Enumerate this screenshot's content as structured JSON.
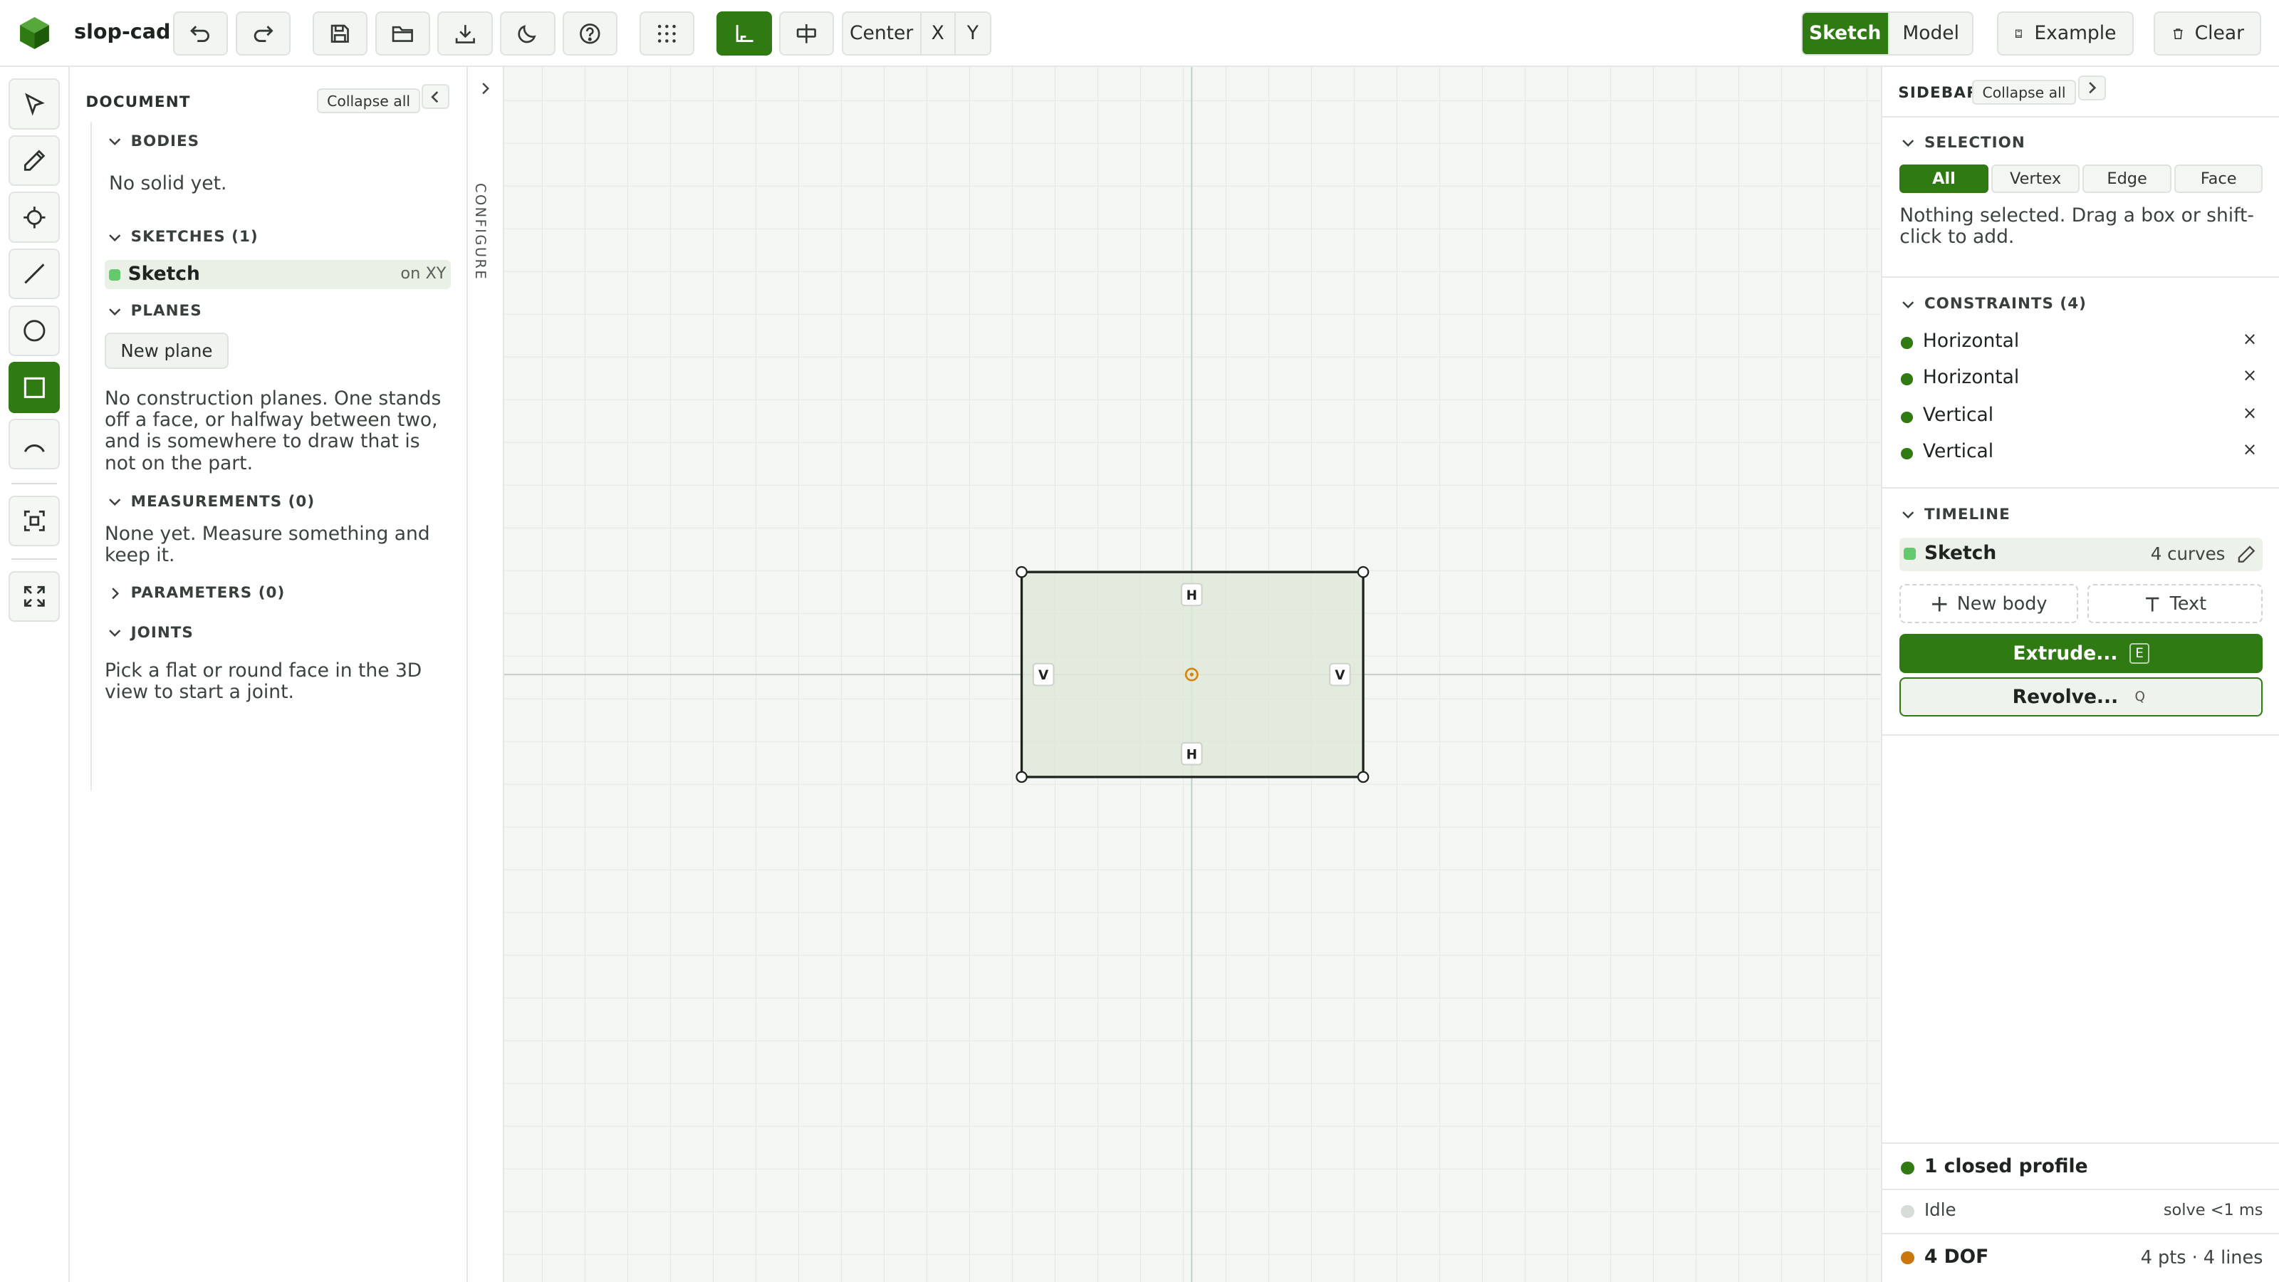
{
  "app": {
    "name": "slop-cad"
  },
  "toolbar": {
    "snap_mode": "Center",
    "axis_x": "X",
    "axis_y": "Y",
    "mode_sketch": "Sketch",
    "mode_model": "Model",
    "example": "Example",
    "clear": "Clear"
  },
  "document": {
    "title": "DOCUMENT",
    "collapse_all": "Collapse all",
    "bodies": {
      "title": "BODIES",
      "empty": "No solid yet."
    },
    "sketches": {
      "title": "SKETCHES (1)",
      "items": [
        {
          "name": "Sketch",
          "plane": "on XY"
        }
      ]
    },
    "planes": {
      "title": "PLANES",
      "new_plane": "New plane",
      "empty": "No construction planes. One stands off a face, or halfway between two, and is somewhere to draw that is not on the part."
    },
    "measurements": {
      "title": "MEASUREMENTS (0)",
      "empty": "None yet. Measure something and keep it."
    },
    "parameters": {
      "title": "PARAMETERS (0)"
    },
    "joints": {
      "title": "JOINTS",
      "empty": "Pick a flat or round face in the 3D view to start a joint."
    }
  },
  "configure": {
    "label": "CONFIGURE"
  },
  "canvas": {
    "constraint_labels": {
      "top": "H",
      "bottom": "H",
      "left": "V",
      "right": "V"
    }
  },
  "sidebar": {
    "title": "SIDEBAR",
    "collapse_all": "Collapse all",
    "selection": {
      "title": "SELECTION",
      "filters": [
        "All",
        "Vertex",
        "Edge",
        "Face"
      ],
      "active_filter": "All",
      "hint": "Nothing selected. Drag a box or shift-click to add."
    },
    "constraints": {
      "title": "CONSTRAINTS (4)",
      "items": [
        "Horizontal",
        "Horizontal",
        "Vertical",
        "Vertical"
      ],
      "remove_glyph": "×"
    },
    "timeline": {
      "title": "TIMELINE",
      "items": [
        {
          "name": "Sketch",
          "meta": "4 curves"
        }
      ],
      "new_body": "New body",
      "text": "Text",
      "extrude": "Extrude...",
      "extrude_key": "E",
      "revolve": "Revolve...",
      "revolve_key": "Q"
    }
  },
  "status": {
    "profile": "1 closed profile",
    "state": "Idle",
    "solve": "solve <1 ms",
    "dof": "4 DOF",
    "counts": "4 pts · 4 lines"
  },
  "colors": {
    "accent": "#2f7a12",
    "sketch_dot": "#63c96b",
    "dof_dot": "#c9760d",
    "idle_dot": "#d8dcd8",
    "origin": "#d4870f"
  },
  "icons": {
    "rail": [
      "pointer-icon",
      "pencil-icon",
      "point-icon",
      "line-icon",
      "circle-icon",
      "rectangle-icon",
      "arc-icon",
      "fit-selection-icon",
      "fullscreen-icon"
    ],
    "toolbar": [
      "undo-icon",
      "redo-icon",
      "save-icon",
      "open-folder-icon",
      "download-icon",
      "moon-icon",
      "help-icon",
      "grid-dots-icon",
      "construction-icon",
      "plane-icon"
    ]
  }
}
